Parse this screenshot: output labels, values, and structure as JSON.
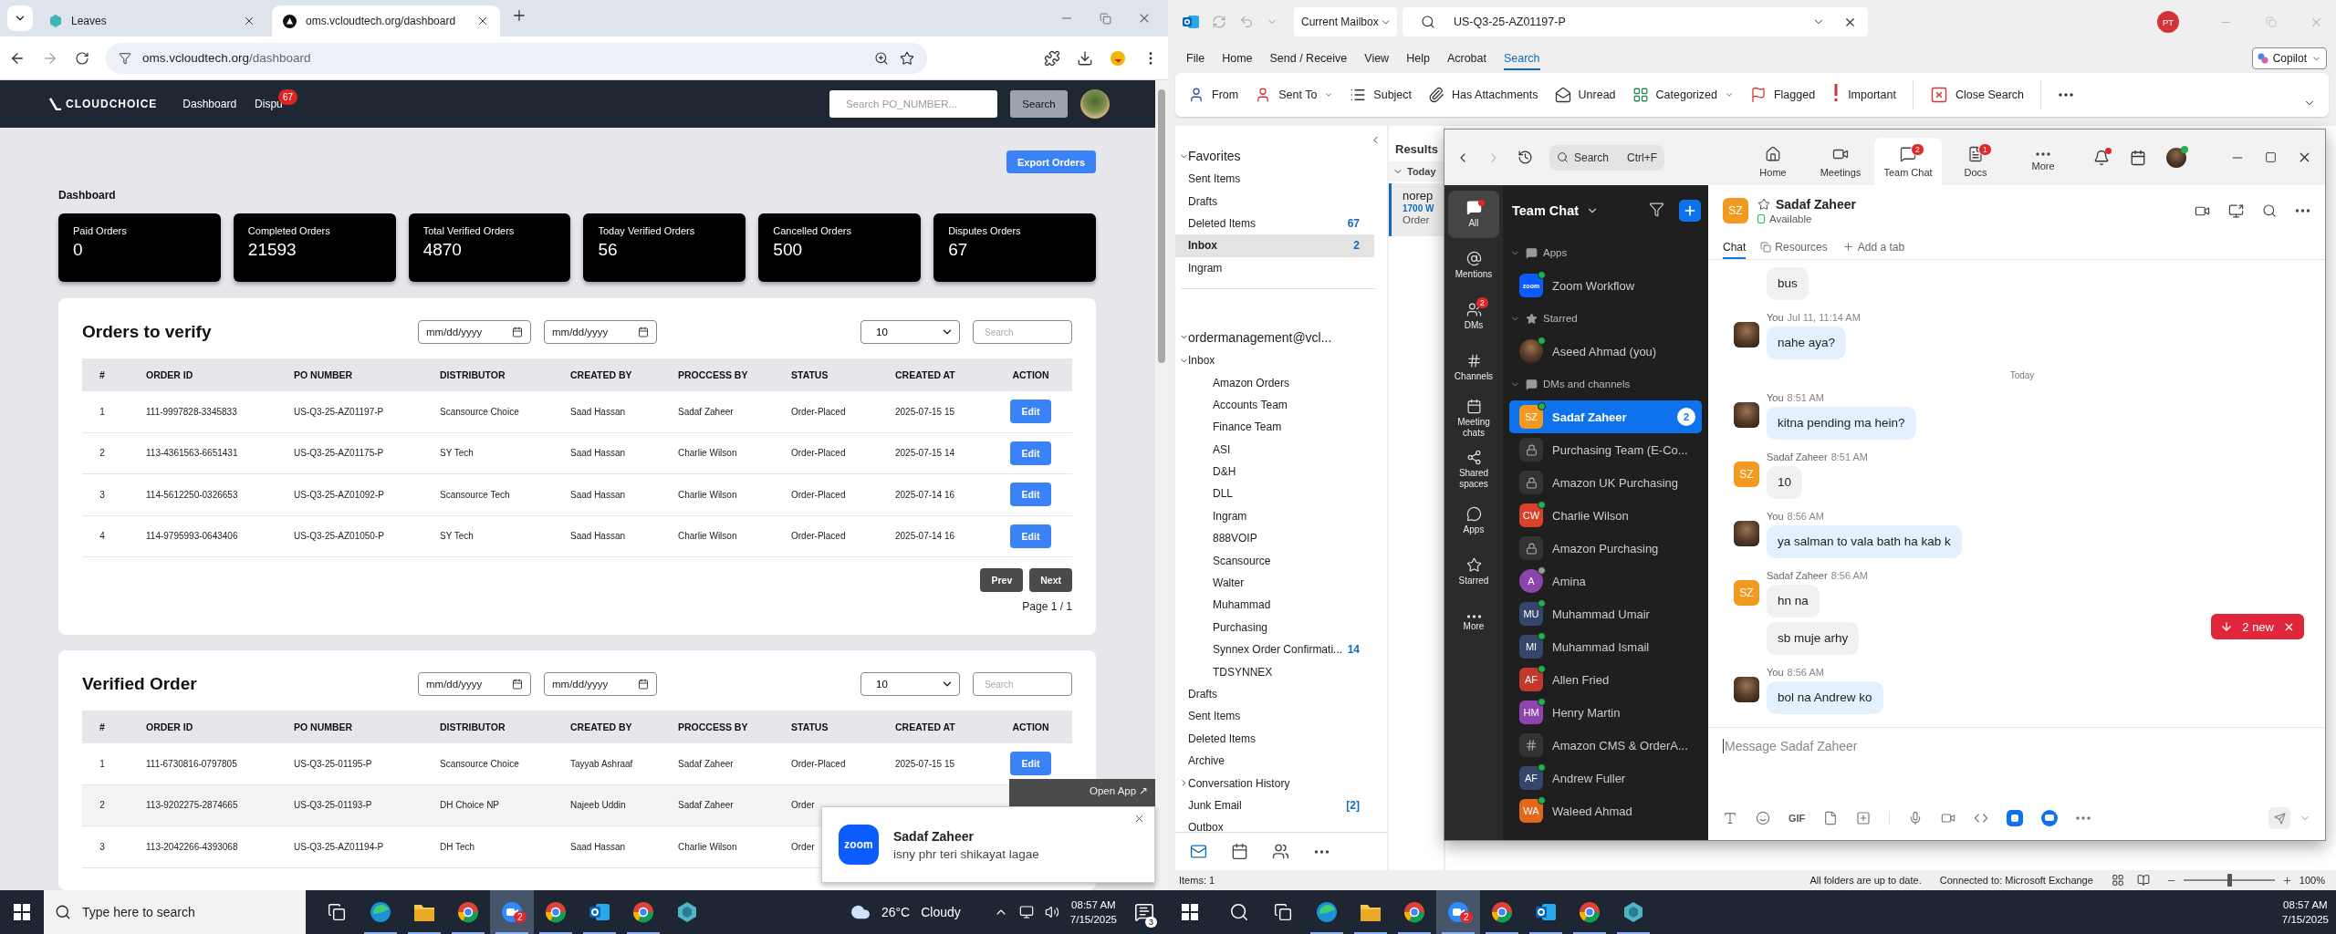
{
  "left_screen": {
    "browser": {
      "tabs": [
        {
          "title": "Leaves",
          "selected": false
        },
        {
          "title": "oms.vcloudtech.org/dashboard",
          "selected": true
        }
      ],
      "address": {
        "host": "oms.vcloudtech.org",
        "path": "/dashboard"
      }
    },
    "site": {
      "logo": "CLOUDCHOICE",
      "nav": [
        {
          "label": "Dashboard"
        },
        {
          "label": "Dispu",
          "badge": "67"
        }
      ],
      "search": {
        "placeholder": "Search PO_NUMBER...",
        "button": "Search"
      },
      "export_button": "Export Orders",
      "heading": "Dashboard",
      "cards": [
        {
          "label": "Paid Orders",
          "value": "0"
        },
        {
          "label": "Completed Orders",
          "value": "21593"
        },
        {
          "label": "Total Verified Orders",
          "value": "4870"
        },
        {
          "label": "Today Verified Orders",
          "value": "56"
        },
        {
          "label": "Cancelled Orders",
          "value": "500"
        },
        {
          "label": "Disputes Orders",
          "value": "67"
        }
      ],
      "tables": [
        {
          "title": "Orders to verify",
          "date_fields": [
            "mm/dd/yyyy",
            "mm/dd/yyyy"
          ],
          "page_size": "10",
          "search_placeholder": "Search",
          "striped": false,
          "columns": [
            "#",
            "ORDER ID",
            "PO NUMBER",
            "DISTRIBUTOR",
            "CREATED BY",
            "PROCCESS BY",
            "STATUS",
            "CREATED AT",
            "ACTION"
          ],
          "rows": [
            {
              "cells": [
                "1",
                "111-9997828-3345833",
                "US-Q3-25-AZ01197-P",
                "Scansource Choice",
                "Saad Hassan",
                "Sadaf Zaheer",
                "Order-Placed",
                "2025-07-15 15"
              ],
              "action": "Edit"
            },
            {
              "cells": [
                "2",
                "113-4361563-6651431",
                "US-Q3-25-AZ01175-P",
                "SY Tech",
                "Saad Hassan",
                "Charlie Wilson",
                "Order-Placed",
                "2025-07-15 14"
              ],
              "action": "Edit"
            },
            {
              "cells": [
                "3",
                "114-5612250-0326653",
                "US-Q3-25-AZ01092-P",
                "Scansource Tech",
                "Saad Hassan",
                "Charlie Wilson",
                "Order-Placed",
                "2025-07-14 16"
              ],
              "action": "Edit"
            },
            {
              "cells": [
                "4",
                "114-9795993-0643406",
                "US-Q3-25-AZ01050-P",
                "SY Tech",
                "Saad Hassan",
                "Charlie Wilson",
                "Order-Placed",
                "2025-07-14 16"
              ],
              "action": "Edit"
            }
          ],
          "pager": {
            "prev": "Prev",
            "next": "Next",
            "page": "Page 1 / 1"
          }
        },
        {
          "title": "Verified Order",
          "date_fields": [
            "mm/dd/yyyy",
            "mm/dd/yyyy"
          ],
          "page_size": "10",
          "search_placeholder": "Search",
          "striped": true,
          "columns": [
            "#",
            "ORDER ID",
            "PO NUMBER",
            "DISTRIBUTOR",
            "CREATED BY",
            "PROCCESS BY",
            "STATUS",
            "CREATED AT",
            "ACTION"
          ],
          "rows": [
            {
              "cells": [
                "1",
                "111-6730816-0797805",
                "US-Q3-25-01195-P",
                "Scansource Choice",
                "Tayyab Ashraaf",
                "Sadaf Zaheer",
                "Order-Placed",
                "2025-07-15 15"
              ],
              "action": "Edit"
            },
            {
              "cells": [
                "2",
                "113-9202275-2874665",
                "US-Q3-25-01193-P",
                "DH Choice NP",
                "Najeeb Uddin",
                "Sadaf Zaheer",
                "Order"
              ]
            },
            {
              "cells": [
                "3",
                "113-2042266-4393068",
                "US-Q3-25-AZ01194-P",
                "DH Tech",
                "Saad Hassan",
                "Charlie Wilson",
                "Order"
              ]
            }
          ]
        }
      ]
    },
    "notification": {
      "open_app": "Open App ↗",
      "app_label": "zoom",
      "sender": "Sadaf Zaheer",
      "message": "isny phr teri shikayat lagae"
    },
    "taskbar": {
      "search_placeholder": "Type here to search",
      "apps": [
        {
          "kind": "taskview",
          "selected": false,
          "running": false
        },
        {
          "kind": "edge",
          "selected": false,
          "running": true
        },
        {
          "kind": "folder",
          "selected": false,
          "running": true
        },
        {
          "kind": "browser",
          "selected": false,
          "running": true
        },
        {
          "kind": "chat",
          "selected": true,
          "running": true,
          "badge": "2"
        },
        {
          "kind": "browser",
          "selected": false,
          "running": true
        },
        {
          "kind": "mail",
          "selected": false,
          "running": true
        },
        {
          "kind": "browser",
          "selected": false,
          "running": true
        },
        {
          "kind": "app",
          "selected": false,
          "running": false
        }
      ],
      "temperature": "26°C",
      "weather": "Cloudy",
      "time": "08:57 AM",
      "date": "7/15/2025",
      "notifications": "3"
    }
  },
  "right_screen": {
    "outlook": {
      "scope": "Current Mailbox",
      "search_query": "US-Q3-25-AZ01197-P",
      "user_initials": "PT",
      "menu": [
        {
          "label": "File",
          "selected": false
        },
        {
          "label": "Home",
          "selected": false
        },
        {
          "label": "Send / Receive",
          "selected": false
        },
        {
          "label": "View",
          "selected": false
        },
        {
          "label": "Help",
          "selected": false
        },
        {
          "label": "Acrobat",
          "selected": false
        },
        {
          "label": "Search",
          "selected": true
        }
      ],
      "copilot": "Copilot",
      "ribbon": [
        {
          "kind": "from",
          "label": "From"
        },
        {
          "kind": "sent_to",
          "label": "Sent To",
          "dropdown": true
        },
        {
          "kind": "subject",
          "label": "Subject"
        },
        {
          "kind": "attachments",
          "label": "Has Attachments"
        },
        {
          "kind": "unread",
          "label": "Unread"
        },
        {
          "kind": "categorized",
          "label": "Categorized",
          "dropdown": true
        },
        {
          "kind": "flagged",
          "label": "Flagged"
        },
        {
          "kind": "important",
          "label": "Important"
        },
        {
          "kind": "close",
          "label": "Close Search"
        }
      ],
      "folders": [
        {
          "label": "Favorites",
          "expanded": true,
          "children": [
            {
              "label": "Sent Items",
              "selected": false
            },
            {
              "label": "Drafts",
              "selected": false
            },
            {
              "label": "Deleted Items",
              "count": "67",
              "selected": false
            },
            {
              "label": "Inbox",
              "count": "2",
              "selected": true
            },
            {
              "label": "Ingram",
              "selected": false
            }
          ]
        },
        {
          "label": "ordermanagement@vcl...",
          "expanded": true,
          "children": [
            {
              "label": "Inbox",
              "expanded": true,
              "selected": false,
              "children": [
                {
                  "label": "Amazon Orders",
                  "selected": false
                },
                {
                  "label": "Accounts Team",
                  "selected": false
                },
                {
                  "label": "Finance Team",
                  "selected": false
                },
                {
                  "label": "ASI",
                  "selected": false
                },
                {
                  "label": "D&H",
                  "selected": false
                },
                {
                  "label": "DLL",
                  "selected": false
                },
                {
                  "label": "Ingram",
                  "selected": false
                },
                {
                  "label": "888VOIP",
                  "selected": false
                },
                {
                  "label": "Scansource",
                  "selected": false
                },
                {
                  "label": "Walter",
                  "selected": false
                },
                {
                  "label": "Muhammad",
                  "selected": false
                },
                {
                  "label": "Purchasing",
                  "selected": false
                },
                {
                  "label": "Synnex Order Confirmati...",
                  "count": "14",
                  "selected": false
                },
                {
                  "label": "TDSYNNEX",
                  "selected": false
                }
              ]
            },
            {
              "label": "Drafts",
              "selected": false
            },
            {
              "label": "Sent Items",
              "selected": false
            },
            {
              "label": "Deleted Items",
              "selected": false
            },
            {
              "label": "Archive",
              "selected": false
            },
            {
              "label": "Conversation History",
              "expanded": false,
              "selected": false
            },
            {
              "label": "Junk Email",
              "count": "[2]",
              "selected": false
            },
            {
              "label": "Outbox",
              "selected": false
            }
          ]
        }
      ],
      "results": {
        "title": "Results",
        "group": "Today",
        "sender": "norep",
        "line2": "1700 W",
        "line3": "Order"
      },
      "status": {
        "items": "Items: 1",
        "sync": "All folders are up to date.",
        "connection": "Connected to: Microsoft Exchange",
        "zoom_level": "100%",
        "level": 0.5
      }
    },
    "zoom_app": {
      "search": "Search",
      "shortcut": "Ctrl+F",
      "top_tabs": [
        {
          "kind": "home",
          "label": "Home",
          "selected": false
        },
        {
          "kind": "meetings",
          "label": "Meetings",
          "selected": false
        },
        {
          "kind": "chat",
          "label": "Team Chat",
          "selected": true,
          "badge": "2"
        },
        {
          "kind": "docs",
          "label": "Docs",
          "selected": false,
          "badge": "1"
        },
        {
          "kind": "more",
          "label": "More",
          "selected": false
        }
      ],
      "rail": [
        {
          "kind": "all",
          "label": "All",
          "selected": true
        },
        {
          "kind": "mentions",
          "label": "Mentions",
          "selected": false
        },
        {
          "kind": "dms",
          "label": "DMs",
          "selected": false,
          "badge": "2"
        },
        {
          "kind": "channels",
          "label": "Channels",
          "selected": false
        },
        {
          "kind": "meetings",
          "label": "Meeting chats",
          "selected": false
        },
        {
          "kind": "shared",
          "label": "Shared spaces",
          "selected": false
        },
        {
          "kind": "apps",
          "label": "Apps",
          "selected": false
        },
        {
          "kind": "starred",
          "label": "Starred",
          "selected": false
        },
        {
          "kind": "more",
          "label": "More",
          "selected": false
        }
      ],
      "sidebar_title": "Team Chat",
      "sections": [
        {
          "kind": "apps",
          "title": "Apps",
          "items": [
            {
              "kind": "app",
              "initials": "zoom",
              "name": "Zoom Workflow",
              "online": true,
              "selected": false
            }
          ]
        },
        {
          "kind": "starred",
          "title": "Starred",
          "items": [
            {
              "kind": "photo",
              "name": "Aseed Ahmad (you)",
              "online": true,
              "selected": false
            }
          ]
        },
        {
          "kind": "dms",
          "title": "DMs and channels",
          "items": [
            {
              "kind": "initials",
              "initials": "SZ",
              "color": "#f29a1f",
              "name": "Sadaf Zaheer",
              "online": true,
              "selected": true,
              "badge": "2"
            },
            {
              "kind": "lock",
              "name": "Purchasing Team (E-Co...",
              "selected": false
            },
            {
              "kind": "lock",
              "name": "Amazon UK Purchasing",
              "selected": false
            },
            {
              "kind": "initials",
              "initials": "CW",
              "color": "#d9412b",
              "name": "Charlie Wilson",
              "online": true,
              "selected": false
            },
            {
              "kind": "lock",
              "name": "Amazon Purchasing",
              "selected": false
            },
            {
              "kind": "initials",
              "initials": "A",
              "color": "#8e44ad",
              "name": "Amina",
              "online": false,
              "selected": false
            },
            {
              "kind": "initials",
              "initials": "MU",
              "color": "#34476a",
              "name": "Muhammad Umair",
              "online": true,
              "selected": false
            },
            {
              "kind": "initials",
              "initials": "MI",
              "color": "#34476a",
              "name": "Muhammad Ismail",
              "online": true,
              "selected": false
            },
            {
              "kind": "initials",
              "initials": "AF",
              "color": "#c0392b",
              "name": "Allen Fried",
              "online": true,
              "selected": false
            },
            {
              "kind": "initials",
              "initials": "HM",
              "color": "#8e44ad",
              "name": "Henry Martin",
              "online": true,
              "selected": false
            },
            {
              "kind": "hash",
              "name": "Amazon CMS & OrderA...",
              "selected": false
            },
            {
              "kind": "initials",
              "initials": "AF",
              "color": "#34476a",
              "name": "Andrew Fuller",
              "online": true,
              "selected": false
            },
            {
              "kind": "initials",
              "initials": "WA",
              "color": "#e2681c",
              "name": "Waleed Ahmad",
              "online": true,
              "selected": false
            }
          ]
        }
      ],
      "chat": {
        "initials": "SZ",
        "color": "#f29a1f",
        "name": "Sadaf Zaheer",
        "status": "Available",
        "tabs": [
          {
            "kind": "chat",
            "label": "Chat",
            "selected": true
          },
          {
            "kind": "resources",
            "label": "Resources",
            "selected": false
          },
          {
            "kind": "add",
            "label": "Add a tab",
            "selected": false
          }
        ],
        "messages": [
          {
            "kind": "theirs",
            "text": "bus"
          },
          {
            "kind": "mine",
            "author": "You",
            "time": "Jul 11, 11:14 AM",
            "text": "nahe aya?"
          },
          {
            "kind": "divider",
            "text": "Today"
          },
          {
            "kind": "mine",
            "author": "You",
            "time": "8:51 AM",
            "text": "kitna pending ma hein?"
          },
          {
            "kind": "theirs",
            "author": "Sadaf Zaheer",
            "time": "8:51 AM",
            "initials": "SZ",
            "color": "#f29a1f",
            "text": "10"
          },
          {
            "kind": "mine",
            "author": "You",
            "time": "8:56 AM",
            "text": "ya salman to vala bath ha kab k"
          },
          {
            "kind": "theirs",
            "author": "Sadaf Zaheer",
            "time": "8:56 AM",
            "initials": "SZ",
            "color": "#f29a1f",
            "text": "hn na"
          },
          {
            "kind": "theirs",
            "text": "sb muje arhy"
          },
          {
            "kind": "mine",
            "author": "You",
            "time": "8:56 AM",
            "text": "bol na Andrew ko"
          }
        ],
        "new_messages": "2 new",
        "composer_placeholder": "Message Sadaf Zaheer",
        "gif": "GIF"
      }
    },
    "taskbar": {
      "apps": [
        {
          "kind": "search",
          "selected": false,
          "running": false
        },
        {
          "kind": "taskview",
          "selected": false,
          "running": false
        },
        {
          "kind": "edge",
          "selected": false,
          "running": true
        },
        {
          "kind": "folder",
          "selected": false,
          "running": true
        },
        {
          "kind": "browser",
          "selected": false,
          "running": true
        },
        {
          "kind": "chat",
          "selected": true,
          "running": true,
          "badge": "2"
        },
        {
          "kind": "browser",
          "selected": false,
          "running": true
        },
        {
          "kind": "mail",
          "selected": false,
          "running": true
        },
        {
          "kind": "browser",
          "selected": false,
          "running": true
        },
        {
          "kind": "app",
          "selected": false,
          "running": true
        }
      ],
      "time": "08:57 AM",
      "date": "7/15/2025"
    }
  }
}
